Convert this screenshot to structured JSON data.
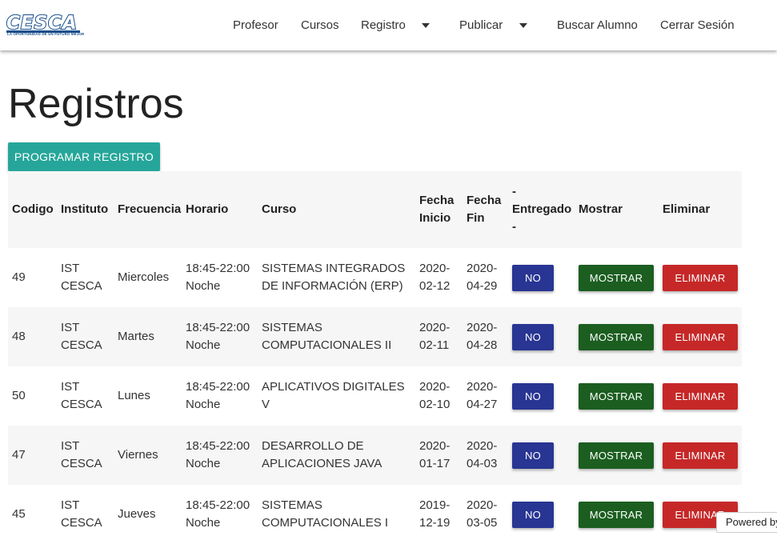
{
  "navbar": {
    "logo_text": "CESCA",
    "logo_tagline": "LA OPORTUNIDAD DE UN FUTURO MEJOR",
    "items": [
      {
        "label": "Profesor"
      },
      {
        "label": "Cursos"
      },
      {
        "label": "Registro",
        "dropdown": true
      },
      {
        "label": "Publicar",
        "dropdown": true
      },
      {
        "label": "Buscar Alumno"
      },
      {
        "label": "Cerrar Sesión"
      }
    ]
  },
  "page": {
    "title": "Registros",
    "program_button": "PROGRAMAR REGISTRO"
  },
  "table": {
    "headers": {
      "codigo": "Codigo",
      "instituto": "Instituto",
      "frecuencia": "Frecuencia",
      "horario": "Horario",
      "curso": "Curso",
      "fecha_inicio": "Fecha Inicio",
      "fecha_fin": "Fecha Fin",
      "entregado": "- Entregado -",
      "mostrar": "Mostrar",
      "eliminar": "Eliminar"
    },
    "rows": [
      {
        "codigo": "49",
        "instituto": "IST CESCA",
        "frecuencia": "Miercoles",
        "horario": "18:45-22:00 Noche",
        "curso": "SISTEMAS INTEGRADOS DE INFORMACIÓN (ERP)",
        "fecha_inicio": "2020-02-12",
        "fecha_fin": "2020-04-29",
        "entregado": "NO",
        "mostrar": "MOSTRAR",
        "eliminar": "ELIMINAR"
      },
      {
        "codigo": "48",
        "instituto": "IST CESCA",
        "frecuencia": "Martes",
        "horario": "18:45-22:00 Noche",
        "curso": "SISTEMAS COMPUTACIONALES II",
        "fecha_inicio": "2020-02-11",
        "fecha_fin": "2020-04-28",
        "entregado": "NO",
        "mostrar": "MOSTRAR",
        "eliminar": "ELIMINAR"
      },
      {
        "codigo": "50",
        "instituto": "IST CESCA",
        "frecuencia": "Lunes",
        "horario": "18:45-22:00 Noche",
        "curso": "APLICATIVOS DIGITALES V",
        "fecha_inicio": "2020-02-10",
        "fecha_fin": "2020-04-27",
        "entregado": "NO",
        "mostrar": "MOSTRAR",
        "eliminar": "ELIMINAR"
      },
      {
        "codigo": "47",
        "instituto": "IST CESCA",
        "frecuencia": "Viernes",
        "horario": "18:45-22:00 Noche",
        "curso": "DESARROLLO DE APLICACIONES JAVA",
        "fecha_inicio": "2020-01-17",
        "fecha_fin": "2020-04-03",
        "entregado": "NO",
        "mostrar": "MOSTRAR",
        "eliminar": "ELIMINAR"
      },
      {
        "codigo": "45",
        "instituto": "IST CESCA",
        "frecuencia": "Jueves",
        "horario": "18:45-22:00 Noche",
        "curso": "SISTEMAS COMPUTACIONALES I",
        "fecha_inicio": "2019-12-19",
        "fecha_fin": "2020-03-05",
        "entregado": "NO",
        "mostrar": "MOSTRAR",
        "eliminar": "ELIMINAR"
      }
    ]
  },
  "footer": {
    "powered_by": "Powered by"
  },
  "colors": {
    "accent": "#26a69a",
    "no_button": "#283593",
    "show_button": "#1b5e20",
    "delete_button": "#c62828",
    "logo_blue": "#1a4f8c"
  }
}
